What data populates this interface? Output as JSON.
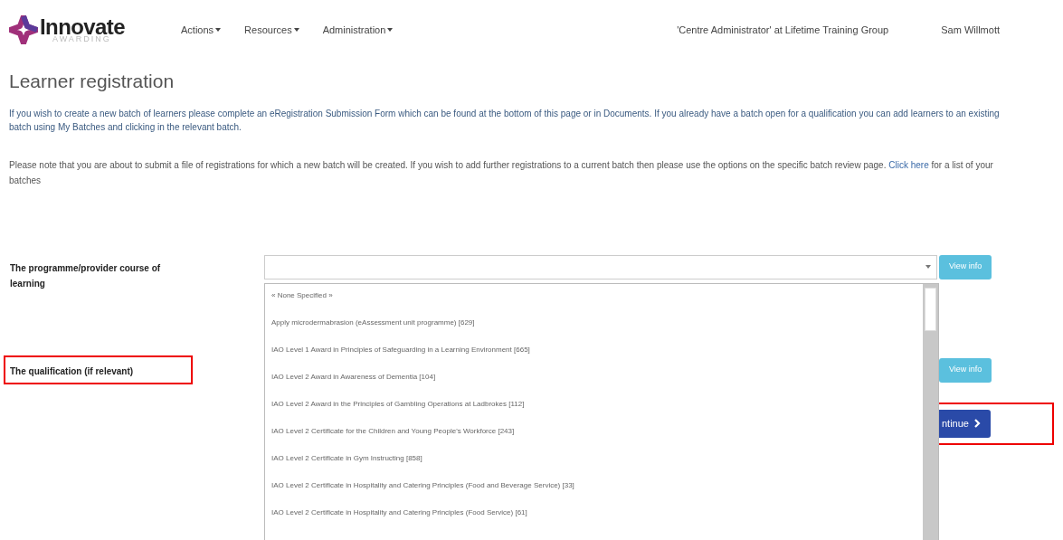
{
  "navbar": {
    "logo": {
      "name": "Innovate",
      "tagline": "AWARDING"
    },
    "menus": [
      {
        "label": "Actions"
      },
      {
        "label": "Resources"
      },
      {
        "label": "Administration"
      }
    ],
    "role": "'Centre Administrator' at Lifetime Training Group",
    "user": "Sam Willmott"
  },
  "title": "Learner registration",
  "intro": "If you wish to create a new batch of learners please complete an eRegistration Submission Form which can be found at the bottom of this page or in Documents. If you already have a batch open for a qualification you can add learners to an existing batch using My Batches and clicking in the relevant batch.",
  "note": {
    "text": "Please note that you are about to submit a file of registrations for which a new batch will be created. If you wish to add further registrations to a current batch then please use the options on the specific batch review page.",
    "link": "Click here",
    "after": "for a list of your batches"
  },
  "fields": [
    {
      "label": "The programme/provider course of learning",
      "button": "View info",
      "highlighted": false
    },
    {
      "label": "The qualification (if relevant)",
      "button": "View info",
      "highlighted": true
    }
  ],
  "dropdown": {
    "options": [
      {
        "label": "« None Specified »"
      },
      {
        "label": "Apply microdermabrasion (eAssessment unit programme) [629]"
      },
      {
        "label": "IAO Level 1 Award in Principles of Safeguarding in a Learning Environment [665]"
      },
      {
        "label": "IAO Level 2 Award in Awareness of Dementia [104]"
      },
      {
        "label": "IAO Level 2 Award in the Principles of Gambling Operations at Ladbrokes [112]"
      },
      {
        "label": "IAO Level 2 Certificate for the Children and Young People's Workforce [243]"
      },
      {
        "label": "IAO Level 2 Certificate in Gym Instructing [858]"
      },
      {
        "label": "IAO Level 2 Certificate in Hospitality and Catering Principles (Food and Beverage Service) [33]"
      },
      {
        "label": "IAO Level 2 Certificate in Hospitality and Catering Principles (Food Service) [61]"
      }
    ]
  },
  "continue_button": {
    "label": "ntinue",
    "highlighted": true
  }
}
